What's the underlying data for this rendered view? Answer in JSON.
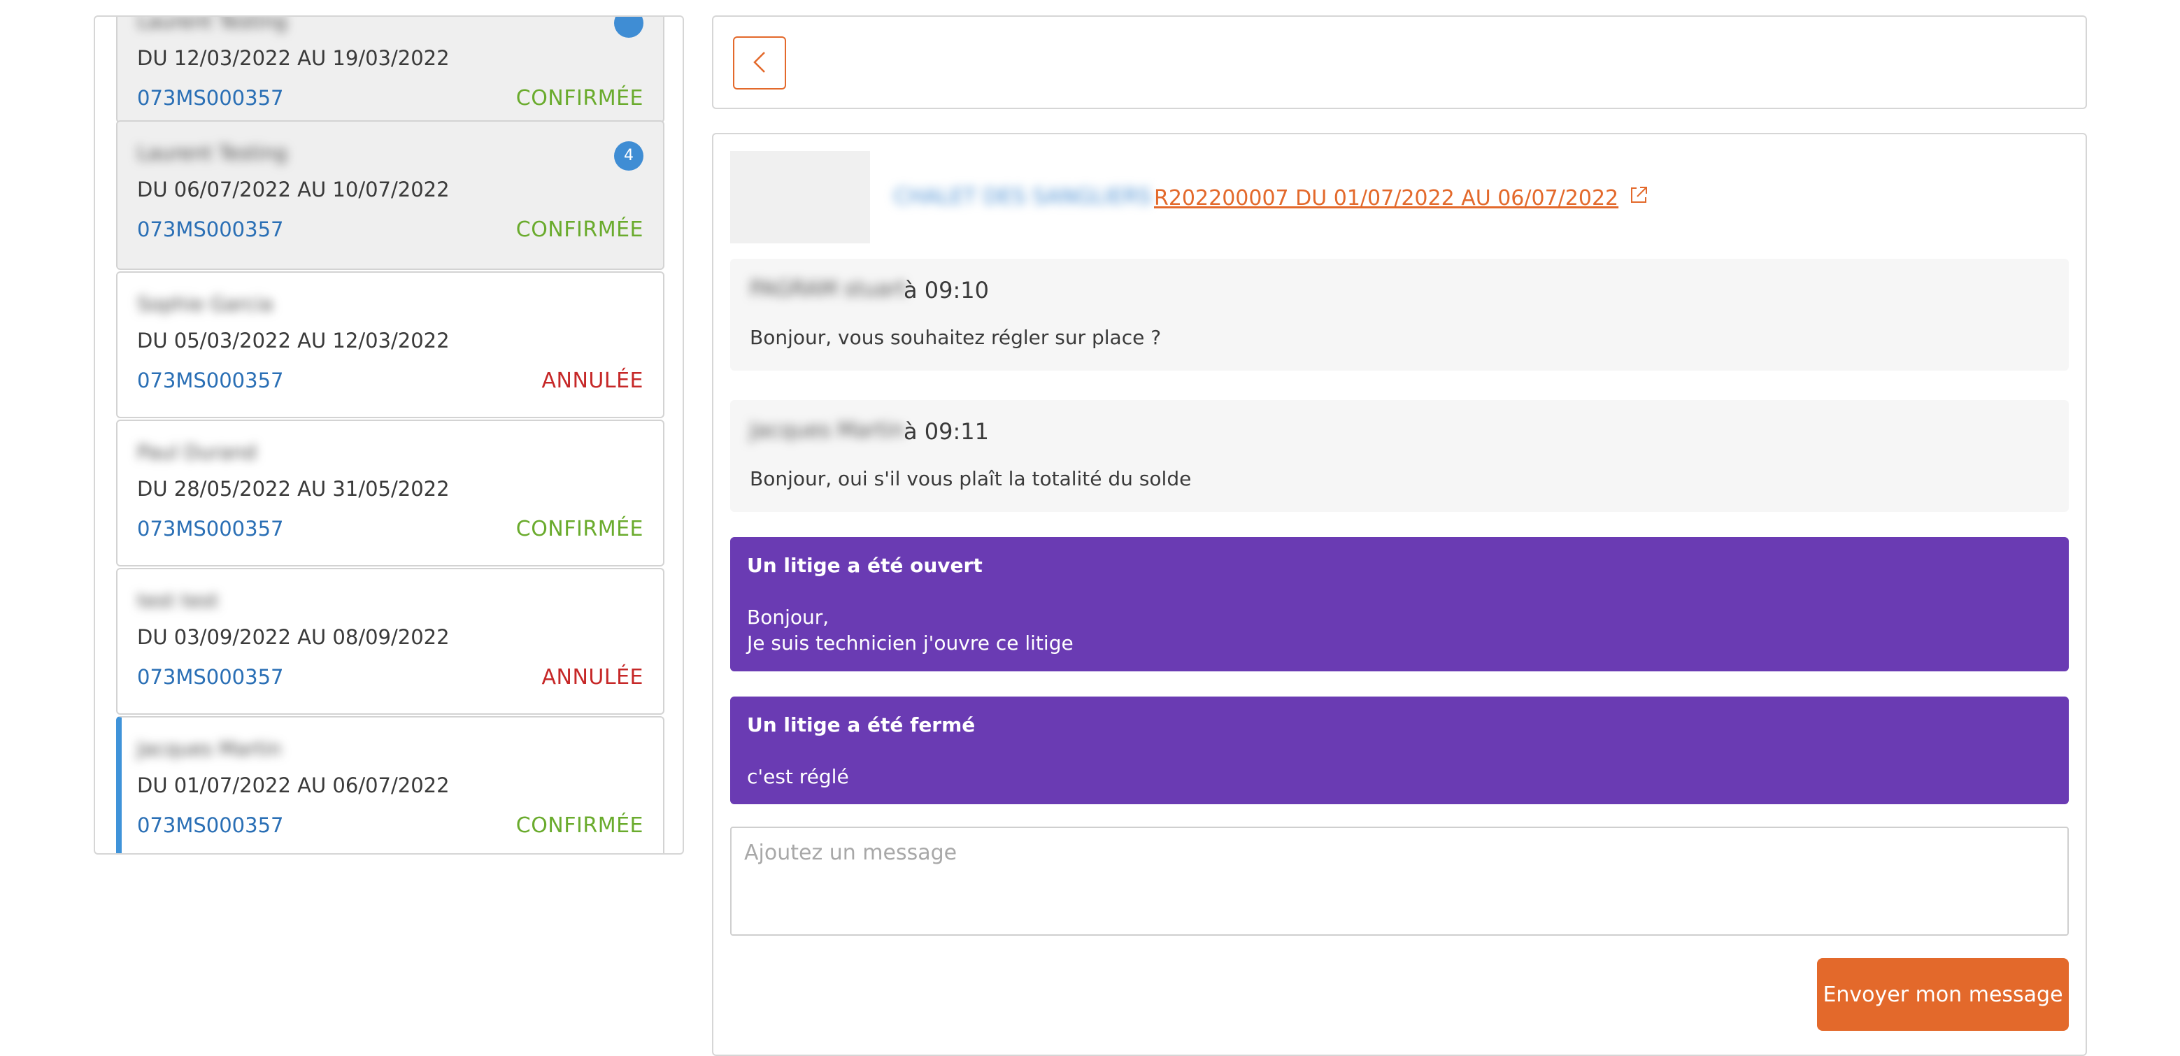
{
  "reservations": [
    {
      "name": "Laurent Testing",
      "dates": "DU 12/03/2022 AU 19/03/2022",
      "ref": "073MS000357",
      "status": "CONFIRMÉE"
    },
    {
      "name": "Laurent Testing",
      "dates": "DU 06/07/2022 AU 10/07/2022",
      "ref": "073MS000357",
      "status": "CONFIRMÉE",
      "unread": "4"
    },
    {
      "name": "Sophie Garcia",
      "dates": "DU 05/03/2022 AU 12/03/2022",
      "ref": "073MS000357",
      "status": "ANNULÉE"
    },
    {
      "name": "Paul Durand",
      "dates": "DU 28/05/2022 AU 31/05/2022",
      "ref": "073MS000357",
      "status": "CONFIRMÉE"
    },
    {
      "name": "test test",
      "dates": "DU 03/09/2022 AU 08/09/2022",
      "ref": "073MS000357",
      "status": "ANNULÉE"
    },
    {
      "name": "Jacques Martin",
      "dates": "DU 01/07/2022 AU 06/07/2022",
      "ref": "073MS000357",
      "status": "CONFIRMÉE"
    }
  ],
  "conversation": {
    "property_name": "CHALET DES SANGLIERS",
    "reservation_link": "R202200007 DU 01/07/2022 AU 06/07/2022",
    "messages": [
      {
        "author": "PAGRAM stuart",
        "time": "à 09:10",
        "text": "Bonjour, vous souhaitez régler sur place ?"
      },
      {
        "author": "Jacques Martin",
        "time": "à 09:11",
        "text": "Bonjour, oui s'il vous plaît la totalité du solde"
      }
    ],
    "disputes": [
      {
        "title": "Un litige a été ouvert",
        "line1": "Bonjour,",
        "line2": "Je suis technicien j'ouvre ce litige"
      },
      {
        "title": "Un litige a été fermé",
        "line1": "c'est réglé"
      }
    ],
    "input_placeholder": "Ajoutez un message",
    "send_label": "Envoyer mon message"
  },
  "colors": {
    "accent": "#e3692b",
    "confirmed": "#6aab2d",
    "cancelled": "#c62828",
    "dispute": "#6a3bb3",
    "link": "#2a6fb5"
  },
  "icons": {
    "back": "chevron-left-icon",
    "external": "external-link-icon"
  }
}
